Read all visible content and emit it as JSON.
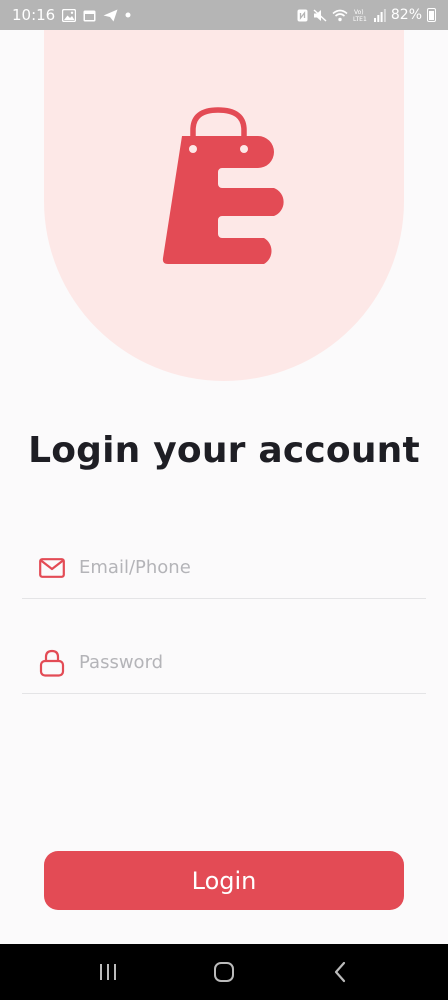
{
  "status_bar": {
    "time": "10:16",
    "battery": "82%",
    "left_icons": [
      "image-icon",
      "calendar-icon",
      "send-icon",
      "dot-icon"
    ],
    "right_icons": [
      "nfc-icon",
      "mute-icon",
      "wifi-icon",
      "volte-icon",
      "signal-icon",
      "battery-icon"
    ]
  },
  "colors": {
    "accent": "#e34b55",
    "hero_bg": "#fde8e7",
    "text_dark": "#1e1e24",
    "placeholder": "#b4b4b8"
  },
  "logo": {
    "icon": "shopping-bag-logo-icon"
  },
  "title": "Login your account",
  "form": {
    "email": {
      "placeholder": "Email/Phone",
      "value": "",
      "icon": "mail-icon"
    },
    "password": {
      "placeholder": "Password",
      "value": "",
      "icon": "lock-icon"
    },
    "login_label": "Login"
  },
  "nav": {
    "items": [
      "recent-apps-icon",
      "home-icon",
      "back-icon"
    ]
  }
}
